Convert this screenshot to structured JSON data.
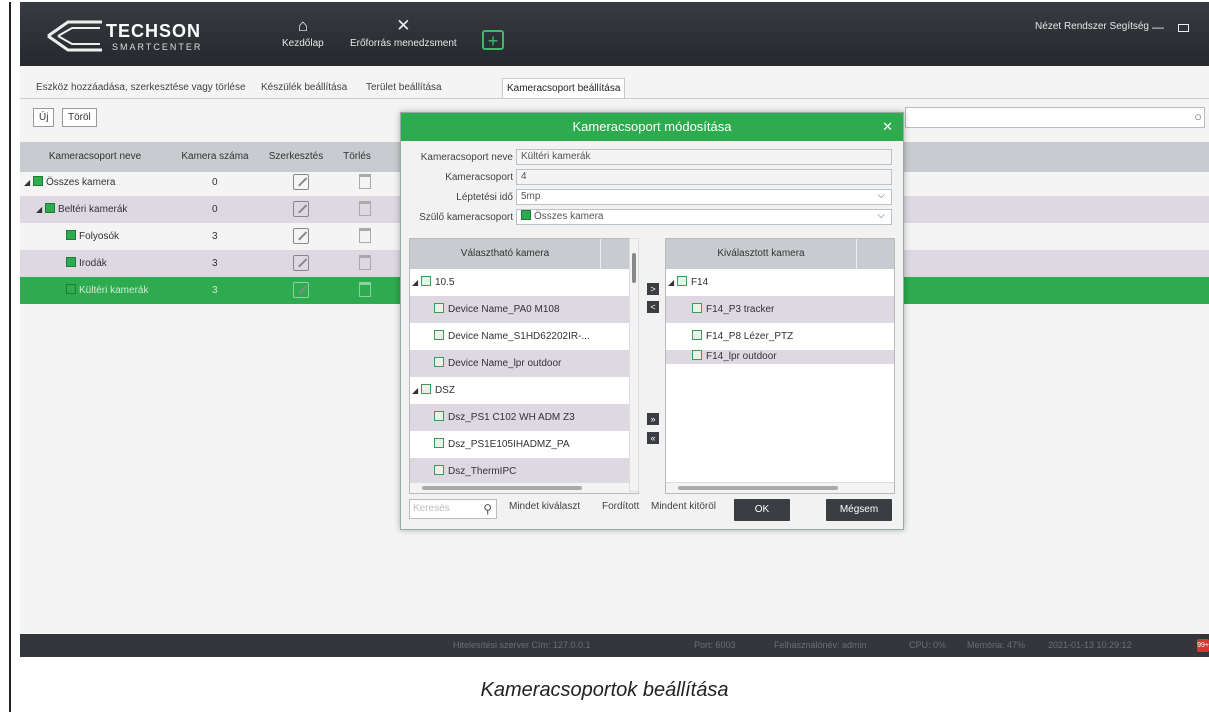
{
  "brand": {
    "name": "TECHSON",
    "sub": "SMARTCENTER"
  },
  "nav": {
    "home": "Kezdőlap",
    "resource": "Erőforrás menedzsment",
    "add_icon": "plus-icon"
  },
  "menu": {
    "items": "Nézet Rendszer Segítség"
  },
  "tabs": [
    "Eszköz hozzáadása, szerkesztése vagy törlése",
    "Készülék beállítása",
    "Terület beállítása",
    "Kameracsoport beállítása"
  ],
  "toolbar": {
    "new": "Új",
    "delete": "Töröl"
  },
  "grid": {
    "headers": [
      "Kameracsoport neve",
      "Kamera száma",
      "Szerkesztés",
      "Törlés"
    ],
    "rows": [
      {
        "name": "Összes kamera",
        "count": "0"
      },
      {
        "name": "Beltéri kamerák",
        "count": "0"
      },
      {
        "name": "Folyosók",
        "count": "3"
      },
      {
        "name": "Irodák",
        "count": "3"
      },
      {
        "name": "Kültéri kamerák",
        "count": "3"
      }
    ]
  },
  "dialog": {
    "title": "Kameracsoport módosítása",
    "fields": {
      "name_label": "Kameracsoport neve",
      "name_value": "Kültéri kamerák",
      "group_label": "Kameracsoport",
      "group_value": "4",
      "step_label": "Léptetési idő",
      "step_value": "5mp",
      "parent_label": "Szülő kameracsoport",
      "parent_value": "Összes kamera"
    },
    "left_panel": {
      "header": "Választható kamera",
      "items": [
        "10.5",
        "Device Name_PA0 M108",
        "Device Name_S1HD62202IR-...",
        "Device Name_lpr outdoor",
        "DSZ",
        "Dsz_PS1 C102 WH ADM Z3",
        "Dsz_PS1E105IHADMZ_PA",
        "Dsz_ThermIPC"
      ]
    },
    "right_panel": {
      "header": "Kiválasztott kamera",
      "items": [
        "F14",
        "F14_P3 tracker",
        "F14_P8 Lézer_PTZ",
        "F14_lpr outdoor"
      ]
    },
    "search_placeholder": "Keresés",
    "select_all": "Mindet kiválaszt",
    "invert": "Fordított",
    "clear_all": "Mindent kitöröl",
    "ok": "OK",
    "cancel": "Mégsem"
  },
  "status": {
    "server": "Hitelesítési szerver Cím: 127.0.0.1",
    "port": "Port: 6003",
    "user": "Felhasználónév: admin",
    "cpu": "CPU: 0%",
    "memory": "Memória: 47%",
    "datetime": "2021-01-13 10:29:12",
    "badge": "99+"
  },
  "caption": "Kameracsoportok beállítása",
  "colors": {
    "accent": "#2eab4e",
    "topbar": "#2b2e33",
    "header": "#c8cbcf",
    "alt_row": "#ddd8e2"
  }
}
